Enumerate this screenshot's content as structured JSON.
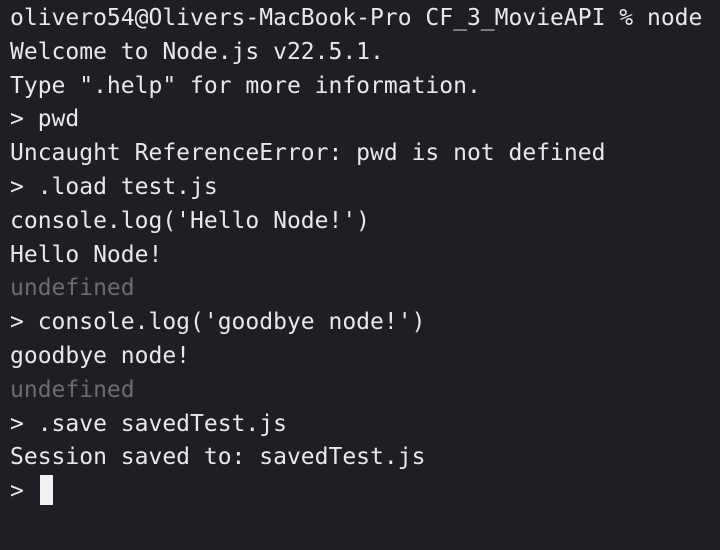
{
  "terminal": {
    "colors": {
      "background": "#1e1f24",
      "text": "#e8e8e8",
      "dim_text": "#6c6c6c",
      "cursor": "#f2f2f2"
    },
    "lines": [
      "olivero54@Olivers-MacBook-Pro CF_3_MovieAPI % node",
      "Welcome to Node.js v22.5.1.",
      "Type \".help\" for more information.",
      "> pwd",
      "Uncaught ReferenceError: pwd is not defined",
      "> .load test.js",
      "console.log('Hello Node!')",
      "Hello Node!",
      "undefined",
      "> console.log('goodbye node!')",
      "goodbye node!",
      "undefined",
      "> .save savedTest.js",
      "Session saved to: savedTest.js"
    ],
    "prompt": ">"
  }
}
